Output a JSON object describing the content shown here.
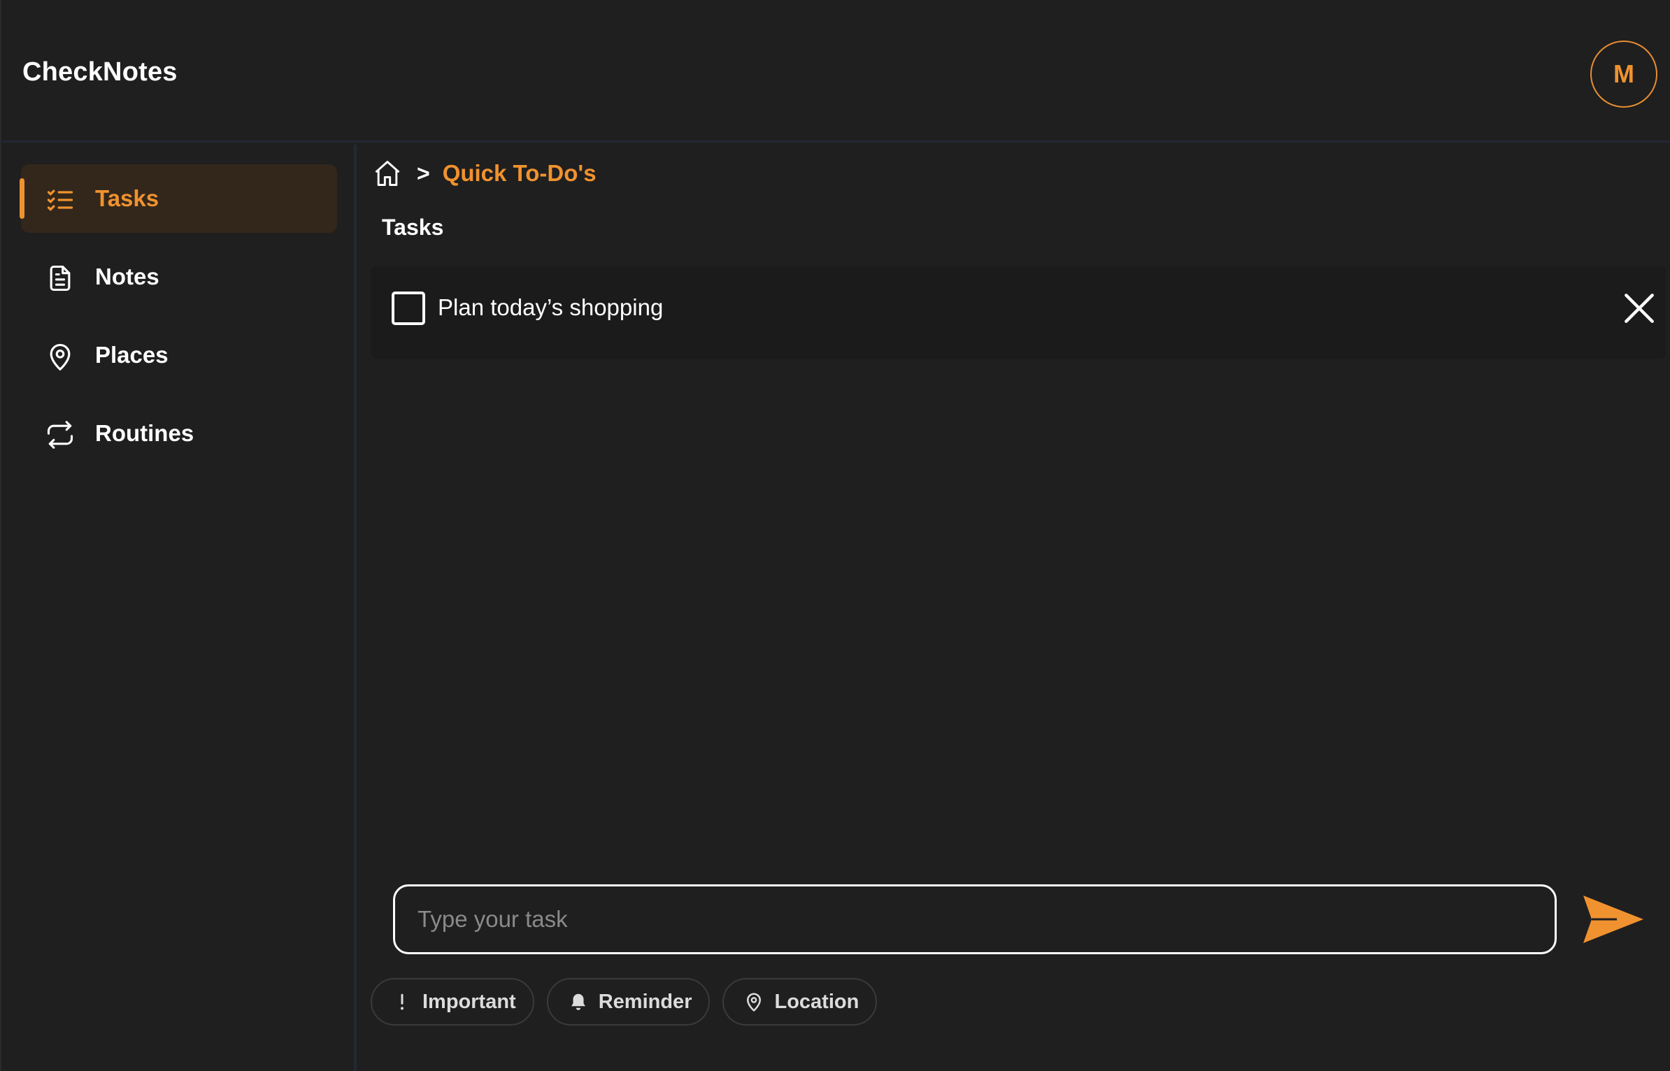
{
  "app": {
    "title": "CheckNotes"
  },
  "user": {
    "avatar_initial": "M"
  },
  "colors": {
    "accent": "#f0922f",
    "background": "#1f1f1f",
    "active_nav_bg": "#33271b"
  },
  "sidebar": {
    "items": [
      {
        "label": "Tasks",
        "icon": "checklist-icon",
        "active": true
      },
      {
        "label": "Notes",
        "icon": "document-icon",
        "active": false
      },
      {
        "label": "Places",
        "icon": "map-pin-icon",
        "active": false
      },
      {
        "label": "Routines",
        "icon": "repeat-icon",
        "active": false
      }
    ]
  },
  "breadcrumb": {
    "separator": ">",
    "current": "Quick To-Do's"
  },
  "main": {
    "section_title": "Tasks",
    "tasks": [
      {
        "text": "Plan today’s shopping",
        "checked": false
      }
    ]
  },
  "composer": {
    "placeholder": "Type your task",
    "chips": [
      {
        "label": "Important",
        "icon": "exclamation-icon"
      },
      {
        "label": "Reminder",
        "icon": "bell-icon"
      },
      {
        "label": "Location",
        "icon": "map-pin-icon"
      }
    ]
  }
}
